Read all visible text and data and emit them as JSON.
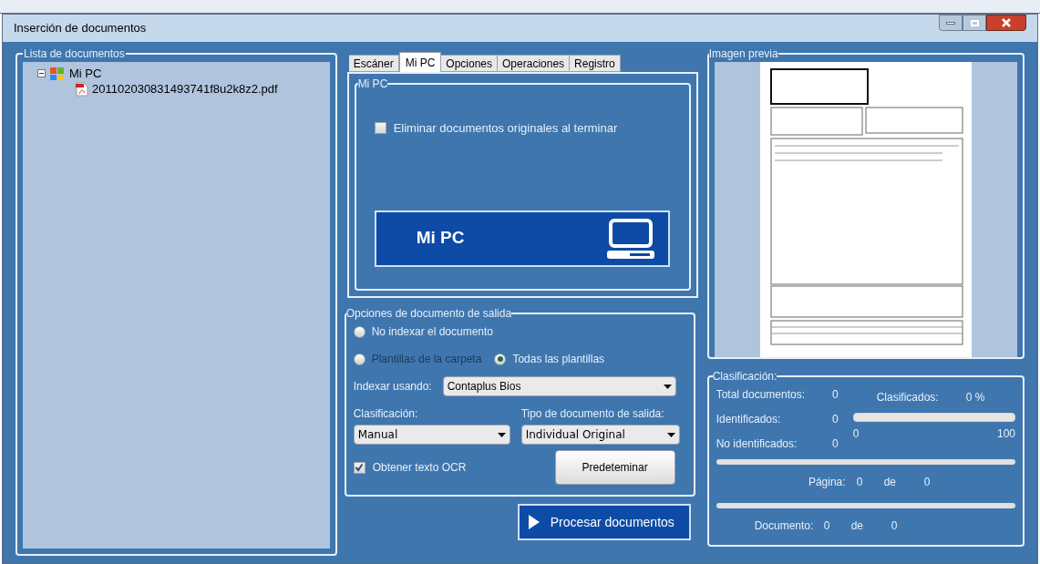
{
  "window": {
    "title": "Inserción de documentos"
  },
  "document_list": {
    "title": "Lista de documentos",
    "tree": [
      {
        "label": "Mi PC",
        "expanded": true,
        "children": [
          {
            "label": "201102030831493741f8u2k8z2.pdf"
          }
        ]
      }
    ]
  },
  "tabs": [
    {
      "label": "Escáner",
      "selected": false
    },
    {
      "label": "Mi PC",
      "selected": true
    },
    {
      "label": "Opciones",
      "selected": false
    },
    {
      "label": "Operaciones",
      "selected": false
    },
    {
      "label": "Registro",
      "selected": false
    }
  ],
  "mi_pc": {
    "title": "Mi PC",
    "delete_originals": {
      "label": "Eliminar documentos originales al terminar",
      "checked": false
    },
    "button": "Mi PC"
  },
  "output_options": {
    "title": "Opciones de documento de salida",
    "radios": [
      {
        "label": "No indexar el documento",
        "selected": false,
        "disabled": false
      },
      {
        "label": "Plantillas de la carpeta",
        "selected": false,
        "disabled": true
      },
      {
        "label": "Todas las plantillas",
        "selected": true,
        "disabled": false
      }
    ],
    "index_using": {
      "label": "Indexar usando:",
      "value": "Contaplus Bios"
    },
    "classification": {
      "label": "Clasificación:",
      "value": "Manual"
    },
    "output_type": {
      "label": "Tipo de documento de salida:",
      "value": "Individual Original"
    },
    "ocr": {
      "label": "Obtener texto OCR",
      "checked": true
    },
    "default_button": "Predeteminar"
  },
  "process_button": "Procesar documentos",
  "preview": {
    "title": "Imagen previa",
    "kind": "picture"
  },
  "classification_panel": {
    "title": "Clasificación:",
    "total": {
      "label": "Total documentos:",
      "value": "0"
    },
    "identified": {
      "label": "Identificados:",
      "value": "0"
    },
    "unidentified": {
      "label": "No identificados:",
      "value": "0"
    },
    "classified": {
      "label": "Clasificados:",
      "value": "0 %",
      "level": 0,
      "min": "0",
      "max": "100"
    },
    "page": {
      "level": 0,
      "label": "Página:",
      "value": "0",
      "of": "de",
      "total": "0"
    },
    "document": {
      "level": 0,
      "label": "Documento:",
      "value": "0",
      "of": "de",
      "total": "0"
    }
  }
}
